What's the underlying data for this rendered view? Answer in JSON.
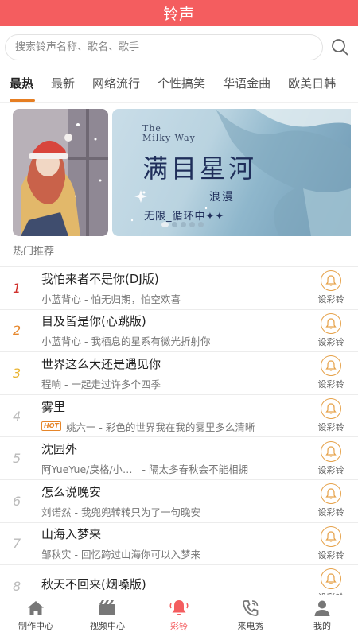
{
  "header": {
    "title": "铃声"
  },
  "search": {
    "placeholder": "搜索铃声名称、歌名、歌手",
    "icon": "search-icon"
  },
  "tabs": [
    {
      "label": "最热",
      "active": true
    },
    {
      "label": "最新"
    },
    {
      "label": "网络流行"
    },
    {
      "label": "个性搞笑"
    },
    {
      "label": "华语金曲"
    },
    {
      "label": "欧美日韩"
    }
  ],
  "banner": {
    "main": {
      "title_en_1": "The",
      "title_en_2": "Milky Way",
      "title_cn": "满目星河",
      "tag_1": "浪漫",
      "tag_2": "无限_循环中✦✦"
    },
    "dots": 5,
    "active_dot": 0
  },
  "section": {
    "title": "热门推荐"
  },
  "ring_label": "设彩铃",
  "songs": [
    {
      "rank": "1",
      "title": "我怕来者不是你(DJ版)",
      "desc": "小蓝背心 - 怕无归期，怕空欢喜",
      "hot": false
    },
    {
      "rank": "2",
      "title": "目及皆是你(心跳版)",
      "desc": "小蓝背心 - 我栖息的星系有微光折射你",
      "hot": false
    },
    {
      "rank": "3",
      "title": "世界这么大还是遇见你",
      "desc": "程响 - 一起走过许多个四季",
      "hot": false
    },
    {
      "rank": "4",
      "title": "雾里",
      "desc": "姚六一 - 彩色的世界我在我的雾里多么清晰",
      "hot": true,
      "hot_label": "HOT"
    },
    {
      "rank": "5",
      "title": "沈园外",
      "desc": "阿YueYue/戾格/小…   - 隔太多春秋会不能相拥",
      "hot": false
    },
    {
      "rank": "6",
      "title": "怎么说晚安",
      "desc": "刘诺然 - 我兜兜转转只为了一句晚安",
      "hot": false
    },
    {
      "rank": "7",
      "title": "山海入梦来",
      "desc": "邹秋实 - 回忆跨过山海你可以入梦来",
      "hot": false
    },
    {
      "rank": "8",
      "title": "秋天不回来(烟嗓版)",
      "desc": "",
      "hot": false
    }
  ],
  "nav": [
    {
      "label": "制作中心",
      "icon": "home-icon"
    },
    {
      "label": "视频中心",
      "icon": "video-icon"
    },
    {
      "label": "彩铃",
      "icon": "bell-icon",
      "active": true
    },
    {
      "label": "来电秀",
      "icon": "phone-icon"
    },
    {
      "label": "我的",
      "icon": "user-icon"
    }
  ],
  "colors": {
    "header": "#f45d5f",
    "accent": "#e67e22",
    "rank1": "#d0312d",
    "rank2": "#e6862a",
    "rank3": "#e9b22c"
  }
}
